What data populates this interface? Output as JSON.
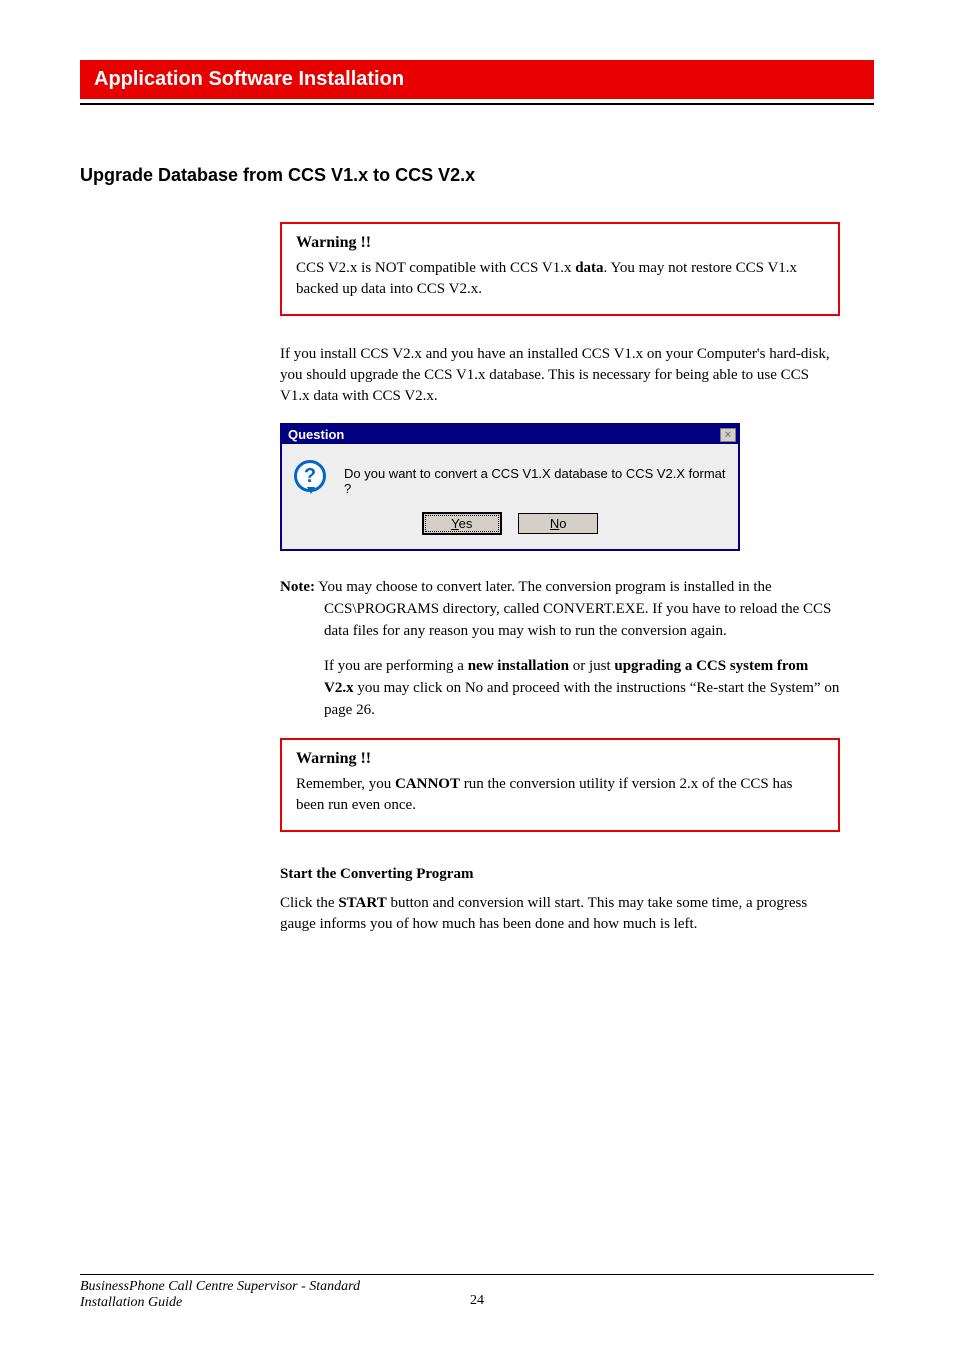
{
  "banner": {
    "title": "Application Software Installation"
  },
  "section": {
    "heading": "Upgrade Database from CCS V1.x to CCS V2.x"
  },
  "warning1": {
    "title": "Warning !!",
    "text_before_bold": "CCS V2.x is NOT compatible with CCS V1.x ",
    "bold": "data",
    "text_after_bold": ". You may not restore CCS V1.x backed up data into CCS V2.x."
  },
  "para1": "If you install CCS V2.x and you have an installed CCS V1.x on your Computer's hard-disk, you should upgrade the CCS V1.x database. This is necessary for being able to use CCS V1.x data with CCS V2.x.",
  "dialog": {
    "title": "Question",
    "close": "×",
    "icon_glyph": "?",
    "message": "Do you want to convert a CCS V1.X database to CCS V2.X format ?",
    "yes_u": "Y",
    "yes_rest": "es",
    "no_u": "N",
    "no_rest": "o"
  },
  "note": {
    "label": "Note:",
    "text1": " You may choose to convert later. The conversion program is installed in the CCS\\PROGRAMS directory, called CONVERT.EXE. If you have to reload the CCS data files for any reason you may wish to run the conversion again.",
    "p2_pre": "If you are performing a ",
    "p2_b1": "new installation",
    "p2_mid": " or just ",
    "p2_b2": "upgrading a CCS system from V2.x",
    "p2_post": " you may click on No and proceed with the instructions “Re-start the System” on page 26."
  },
  "warning2": {
    "title": "Warning !!",
    "pre": "Remember, you ",
    "bold": "CANNOT",
    "post": " run the conversion utility if version 2.x of the CCS has been run even once."
  },
  "subheading": "Start the Converting Program",
  "para2_pre": "Click the ",
  "para2_bold": "START",
  "para2_post": " button and conversion will start. This may take some time, a progress gauge informs you of how much has been done and how much is left.",
  "footer": {
    "line1": "BusinessPhone Call Centre Supervisor - Standard",
    "line2": "Installation Guide",
    "page": "24"
  }
}
